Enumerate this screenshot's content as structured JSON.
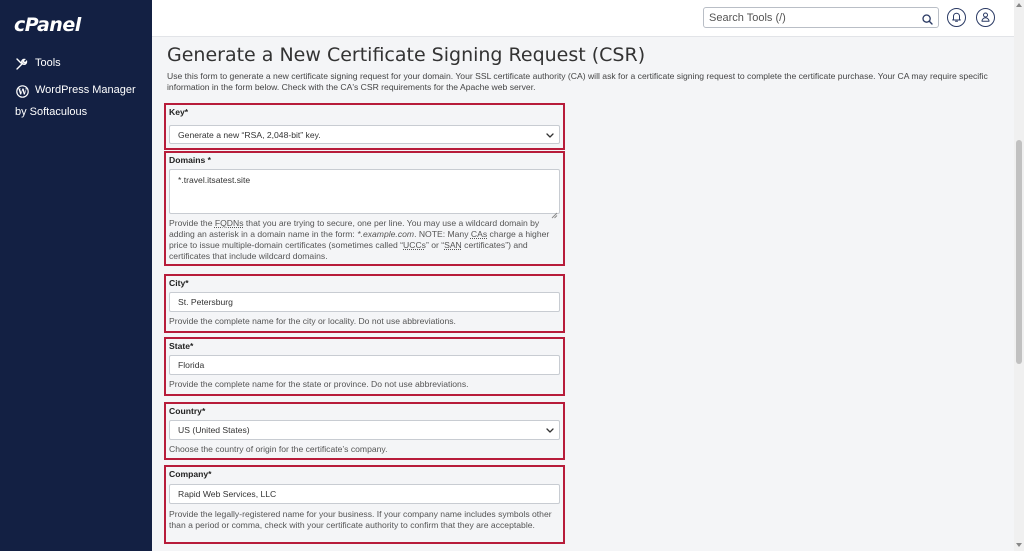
{
  "app": {
    "logo": "cPanel"
  },
  "sidebar": {
    "items": [
      {
        "label": "Tools",
        "icon": "tools-icon"
      },
      {
        "label": "WordPress Manager",
        "sublabel": "by Softaculous",
        "icon": "wordpress-icon"
      }
    ]
  },
  "header": {
    "search_placeholder": "Search Tools (/)",
    "icons": [
      "search-icon",
      "bell-icon",
      "user-icon"
    ]
  },
  "page": {
    "title": "Generate a New Certificate Signing Request (CSR)",
    "intro": "Use this form to generate a new certificate signing request for your domain. Your SSL certificate authority (CA) will ask for a certificate signing request to complete the certificate purchase. Your CA may require specific information in the form below. Check with the CA's CSR requirements for the Apache web server."
  },
  "form": {
    "key": {
      "label": "Key*",
      "value": "Generate a new “RSA, 2,048-bit” key."
    },
    "domains": {
      "label": "Domains *",
      "value": "*.travel.itsatest.site",
      "help": {
        "p1": "Provide the ",
        "fqdn": "FQDNs",
        "p2": " that you are trying to secure, one per line. You may use a wildcard domain by adding an asterisk in a domain name in the form: ",
        "example": "*.example.com",
        "p3": ". NOTE: Many ",
        "cas": "CAs",
        "p4": " charge a higher price to issue multiple-domain certificates (sometimes called “",
        "uccs": "UCCs",
        "p5": "” or “",
        "san": "SAN",
        "p6": " certificates”) and certificates that include wildcard domains."
      }
    },
    "city": {
      "label": "City*",
      "value": "St. Petersburg",
      "help": "Provide the complete name for the city or locality. Do not use abbreviations."
    },
    "state": {
      "label": "State*",
      "value": "Florida",
      "help": "Provide the complete name for the state or province. Do not use abbreviations."
    },
    "country": {
      "label": "Country*",
      "value": "US (United States)",
      "help": "Choose the country of origin for the certificate’s company."
    },
    "company": {
      "label": "Company*",
      "value": "Rapid Web Services, LLC",
      "help": "Provide the legally-registered name for your business. If your company name includes symbols other than a period or comma, check with your certificate authority to confirm that they are acceptable."
    }
  },
  "colors": {
    "sidebar_bg": "#132043",
    "highlight_border": "#b71c3a",
    "page_bg": "#f4f5f7"
  }
}
